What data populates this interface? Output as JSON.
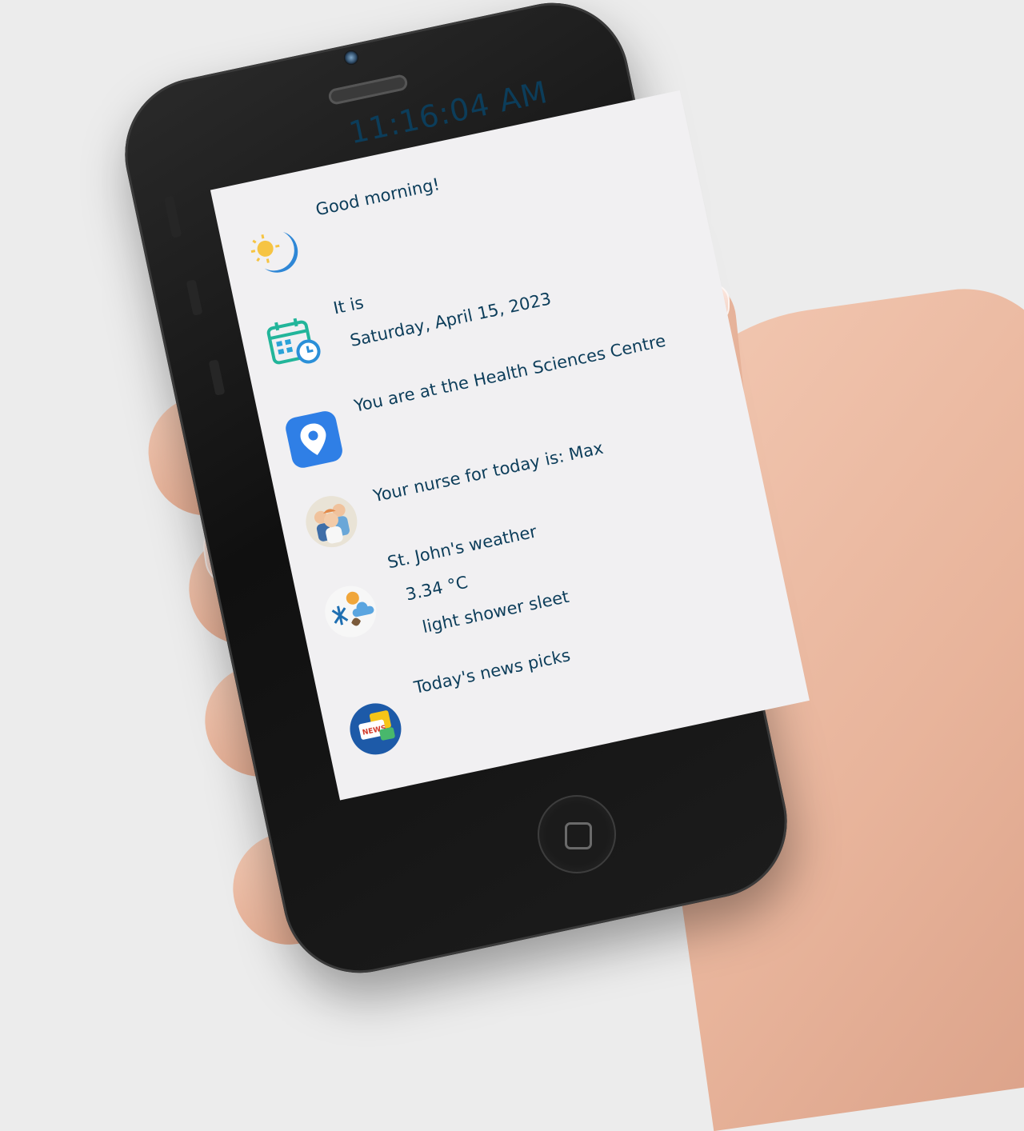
{
  "clock": "11:16:04 AM",
  "greeting": {
    "icon": "sun-moon-icon",
    "text": "Good morning!"
  },
  "date": {
    "icon": "calendar-icon",
    "line1": "It is",
    "line2": "Saturday, April 15, 2023"
  },
  "location": {
    "icon": "location-pin-icon",
    "text": "You are at the Health Sciences Centre"
  },
  "nurse": {
    "icon": "nurses-icon",
    "text": "Your nurse for today is: Max"
  },
  "weather": {
    "icon": "weather-icon",
    "title": "St. John's weather",
    "temp": "3.34 °C",
    "condition": "light shower sleet"
  },
  "news": {
    "icon": "news-icon",
    "text": "Today's news picks"
  },
  "colors": {
    "text": "#0c3d5a",
    "screen": "#f1f0f2",
    "pin": "#2f7fe6"
  }
}
